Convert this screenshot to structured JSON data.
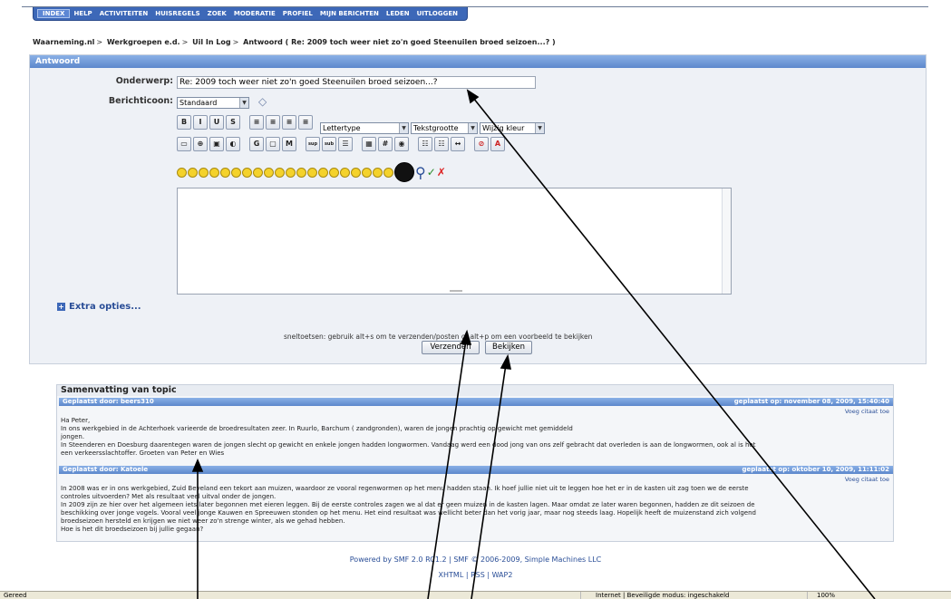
{
  "nav": {
    "items": [
      "INDEX",
      "HELP",
      "ACTIVITEITEN",
      "HUISREGELS",
      "ZOEK",
      "MODERATIE",
      "PROFIEL",
      "MIJN BERICHTEN",
      "LEDEN",
      "UITLOGGEN"
    ]
  },
  "breadcrumb": {
    "items": [
      "Waarneming.nl",
      "Werkgroepen e.d.",
      "Uil In Log",
      "Antwoord ( Re: 2009 toch weer niet zo'n goed Steenuilen broed seizoen...? )"
    ],
    "separator": ">"
  },
  "form": {
    "title": "Antwoord",
    "subject_label": "Onderwerp:",
    "subject_value": "Re: 2009 toch weer niet zo'n goed Steenuilen broed seizoen...?",
    "icon_label": "Berichticoon:",
    "icon_value": "Standaard",
    "font_select": "Lettertype",
    "size_select": "Tekstgrootte",
    "color_select": "Wijzig kleur",
    "toolbar_row1": [
      "B",
      "I",
      "U",
      "S",
      "≡",
      "≡",
      "≡",
      "≡"
    ],
    "toolbar_row2": [
      "▭",
      "⊕",
      "▣",
      "◐",
      "G",
      "▢",
      "M",
      "sup",
      "sub",
      "☰",
      "▦",
      "#",
      "◉",
      "☷",
      "☷",
      "↔",
      "⊘",
      "A"
    ],
    "extra_options": "Extra opties...",
    "hint": "sneltoetsen: gebruik alt+s om te verzenden/posten of alt+p om een voorbeeld te bekijken",
    "submit_label": "Verzenden",
    "preview_label": "Bekijken"
  },
  "summary": {
    "title": "Samenvatting van topic",
    "quote_label": "Voeg citaat toe",
    "posts": [
      {
        "author": "Geplaatst door: beers310",
        "date": "geplaatst op: november 08, 2009, 15:40:40",
        "lines": [
          "Ha Peter,",
          "In ons werkgebied in de Achterhoek varieerde de broedresultaten zeer. In Ruurlo, Barchum ( zandgronden), waren de jongen prachtig op gewicht met gemiddeld",
          "jongen.",
          "In Steenderen en Doesburg daarentegen waren de jongen slecht op gewicht en enkele jongen hadden longwormen. Vandaag werd een dood jong van ons zelf gebracht dat overleden is aan de longwormen, ook al is het",
          "een verkeersslachtoffer. Groeten van Peter en Wies"
        ]
      },
      {
        "author": "Geplaatst door: Katoele",
        "date": "geplaatst op: oktober 10, 2009, 11:11:02",
        "lines": [
          "In 2008 was er in ons werkgebied, Zuid Beveland een tekort aan muizen, waardoor ze vooral regenwormen op het menu hadden staan. Ik hoef jullie niet uit te leggen hoe het er in de kasten uit zag toen we de eerste",
          "controles uitvoerden? Met als resultaat veel uitval onder de jongen.",
          "In 2009 zijn ze hier over het algemeen iets later begonnen met eieren leggen. Bij de eerste controles zagen we al dat er geen muizen in de kasten lagen. Maar omdat ze later waren begonnen, hadden ze dit seizoen de",
          "beschikking over jonge vogels. Vooral veel jonge Kauwen en Spreeuwen stonden op het menu. Het eind resultaat was wellicht beter dan het vorig jaar, maar nog steeds laag. Hopelijk heeft de muizenstand zich volgend",
          "broedseizoen hersteld en krijgen we niet weer zo'n strenge winter, als we gehad hebben.",
          "Hoe is het dit broedseizoen bij jullie gegaan?"
        ]
      }
    ]
  },
  "footer": {
    "powered": "Powered by SMF 2.0 RC1.2 | SMF © 2006-2009, Simple Machines LLC",
    "links": "XHTML | RSS | WAP2"
  },
  "statusbar": {
    "left": "Gereed",
    "zone": "Internet | Beveiligde modus: ingeschakeld",
    "zoom": "100%"
  }
}
